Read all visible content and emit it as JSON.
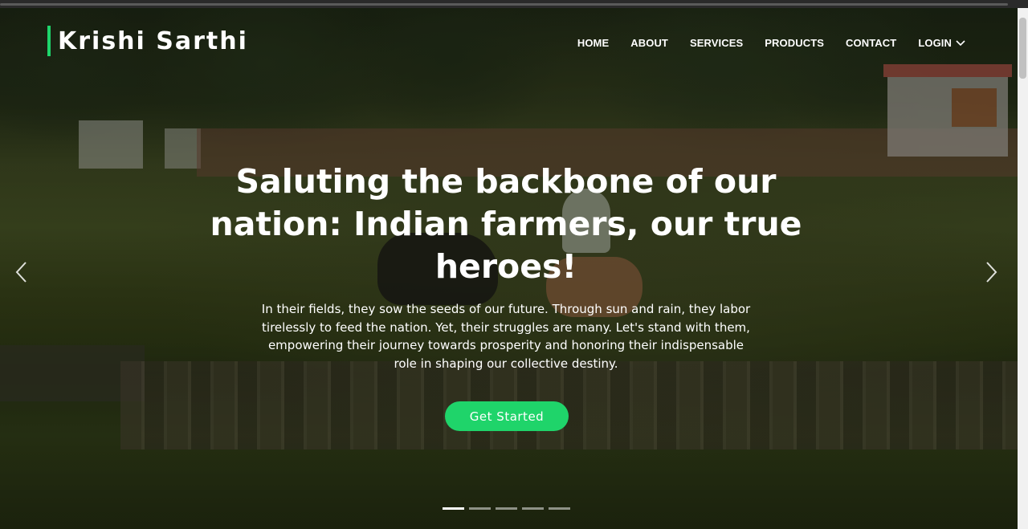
{
  "brand": {
    "name": "Krishi Sarthi",
    "accent_color": "#1ed56b"
  },
  "nav": {
    "items": [
      {
        "label": "HOME"
      },
      {
        "label": "ABOUT"
      },
      {
        "label": "SERVICES"
      },
      {
        "label": "PRODUCTS"
      },
      {
        "label": "CONTACT"
      },
      {
        "label": "LOGIN",
        "icon": "chevron-down-icon"
      }
    ]
  },
  "hero": {
    "headline": "Saluting the backbone of our nation: Indian farmers, our true heroes!",
    "description": "In their fields, they sow the seeds of our future. Through sun and rain, they labor tirelessly to feed the nation. Yet, their struggles are many. Let's stand with them, empowering their journey towards prosperity and honoring their indispensable role in shaping our collective destiny.",
    "cta_label": "Get Started",
    "cta_color": "#1fd46a",
    "prev_icon": "chevron-left-icon",
    "next_icon": "chevron-right-icon",
    "slide_count": 5,
    "active_slide": 1
  }
}
